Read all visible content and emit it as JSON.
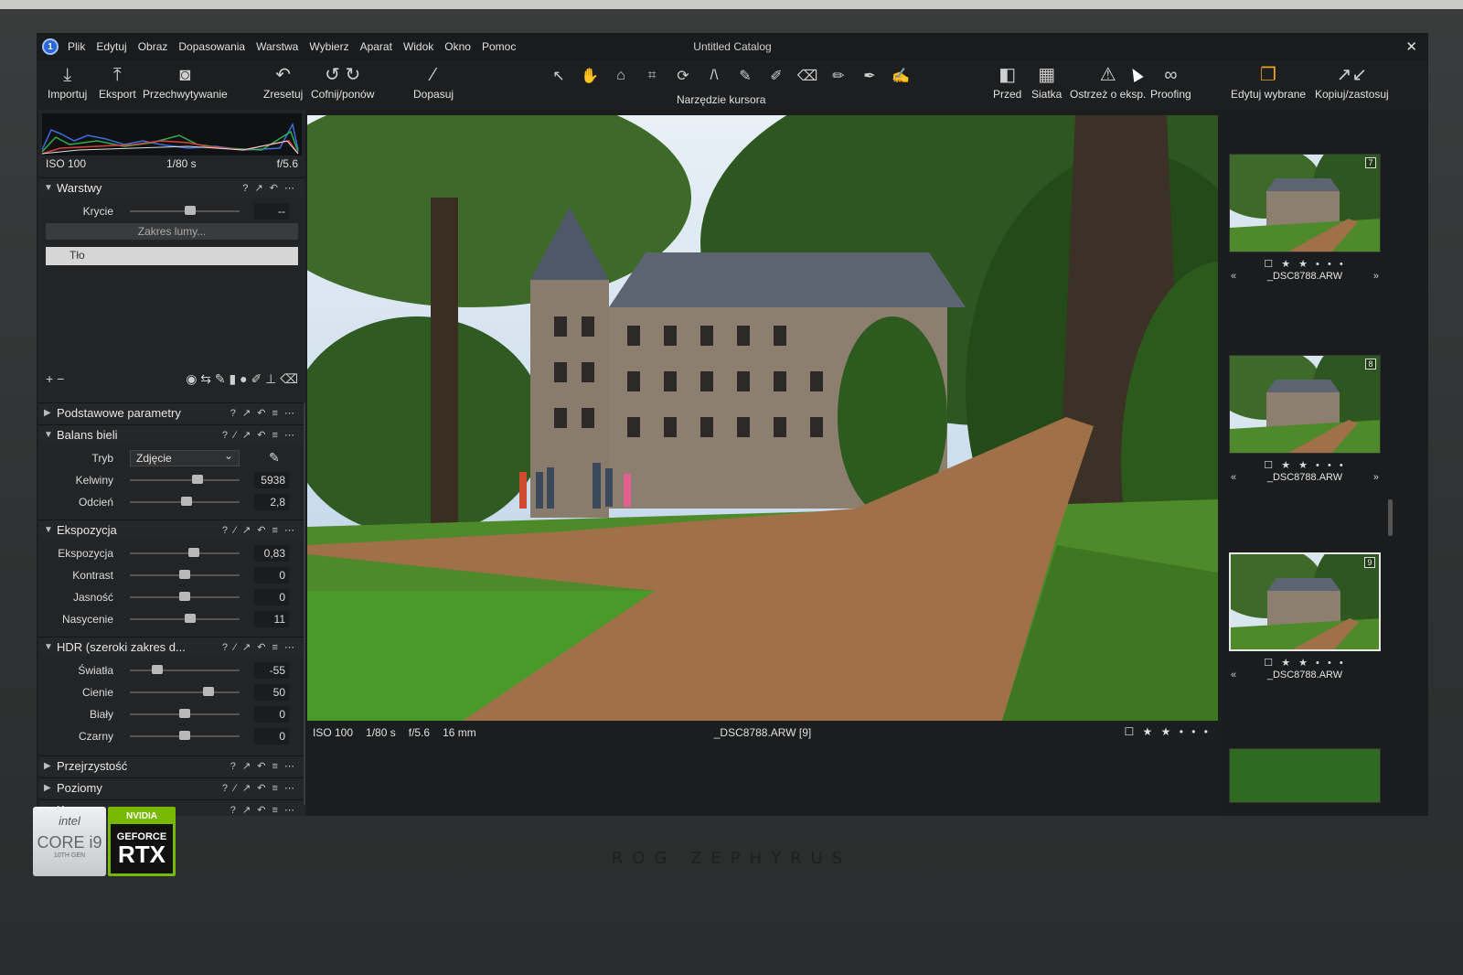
{
  "window": {
    "title": "Untitled Catalog"
  },
  "menu": [
    "Plik",
    "Edytuj",
    "Obraz",
    "Dopasowania",
    "Warstwa",
    "Wybierz",
    "Aparat",
    "Widok",
    "Okno",
    "Pomoc"
  ],
  "toolbar": {
    "left": [
      {
        "label": "Importuj",
        "icon": "import-icon"
      },
      {
        "label": "Eksport",
        "icon": "export-icon"
      },
      {
        "label": "Przechwytywanie",
        "icon": "camera-icon"
      },
      {
        "label": "Zresetuj",
        "icon": "reset-icon"
      },
      {
        "label": "Cofnij/ponów",
        "icon": "undo-redo-icon"
      },
      {
        "label": "Dopasuj",
        "icon": "magic-wand-icon"
      }
    ],
    "cursor_tools_label": "Narzędzie kursora",
    "right": [
      {
        "label": "Przed",
        "icon": "before-after-icon"
      },
      {
        "label": "Siatka",
        "icon": "grid-icon"
      },
      {
        "label": "Ostrzeż o eksp.",
        "icon": "warning-icon"
      },
      {
        "label": "Proofing",
        "icon": "glasses-icon"
      },
      {
        "label": "Edytuj wybrane",
        "icon": "edit-selected-icon"
      },
      {
        "label": "Kopiuj/zastosuj",
        "icon": "copy-apply-icon"
      }
    ]
  },
  "histogram": {
    "iso": "ISO 100",
    "shutter": "1/80 s",
    "aperture": "f/5.6"
  },
  "layers": {
    "title": "Warstwy",
    "opacity_label": "Krycie",
    "opacity_value": "--",
    "luma_range": "Zakres lumy...",
    "layer_name": "Tło"
  },
  "sections": {
    "basic": "Podstawowe parametry",
    "white_balance": {
      "title": "Balans bieli",
      "mode_label": "Tryb",
      "mode_value": "Zdjęcie",
      "params": [
        {
          "label": "Kelwiny",
          "value": "5938",
          "pos": 0.62
        },
        {
          "label": "Odcień",
          "value": "2,8",
          "pos": 0.52
        }
      ]
    },
    "exposure": {
      "title": "Ekspozycja",
      "params": [
        {
          "label": "Ekspozycja",
          "value": "0,83",
          "pos": 0.58
        },
        {
          "label": "Kontrast",
          "value": "0",
          "pos": 0.5
        },
        {
          "label": "Jasność",
          "value": "0",
          "pos": 0.5
        },
        {
          "label": "Nasycenie",
          "value": "11",
          "pos": 0.55
        }
      ]
    },
    "hdr": {
      "title": "HDR (szeroki zakres d...",
      "params": [
        {
          "label": "Światła",
          "value": "-55",
          "pos": 0.25
        },
        {
          "label": "Cienie",
          "value": "50",
          "pos": 0.72
        },
        {
          "label": "Biały",
          "value": "0",
          "pos": 0.5
        },
        {
          "label": "Czarny",
          "value": "0",
          "pos": 0.5
        }
      ]
    },
    "clarity": "Przejrzystość",
    "levels": "Poziomy",
    "curves": "Krzywe"
  },
  "viewer": {
    "iso": "ISO 100",
    "shutter": "1/80 s",
    "aperture": "f/5.6",
    "focal": "16 mm",
    "filename": "_DSC8788.ARW [9]",
    "rating": "☐ ★ ★ • • •"
  },
  "thumbnails": [
    {
      "num": "7",
      "rating": "☐ ★ ★ • • •",
      "name": "_DSC8788.ARW"
    },
    {
      "num": "8",
      "rating": "☐ ★ ★ • • •",
      "name": "_DSC8788.ARW"
    },
    {
      "num": "9",
      "rating": "☐ ★ ★ • • •",
      "name": "_DSC8788.ARW"
    }
  ],
  "stickers": {
    "intel": {
      "brand": "intel",
      "line1": "CORE i9",
      "line2": "10TH GEN"
    },
    "nvidia": {
      "brand": "NVIDIA",
      "line1": "GEFORCE",
      "line2": "RTX"
    }
  },
  "device_brand": "ROG ZEPHYRUS"
}
